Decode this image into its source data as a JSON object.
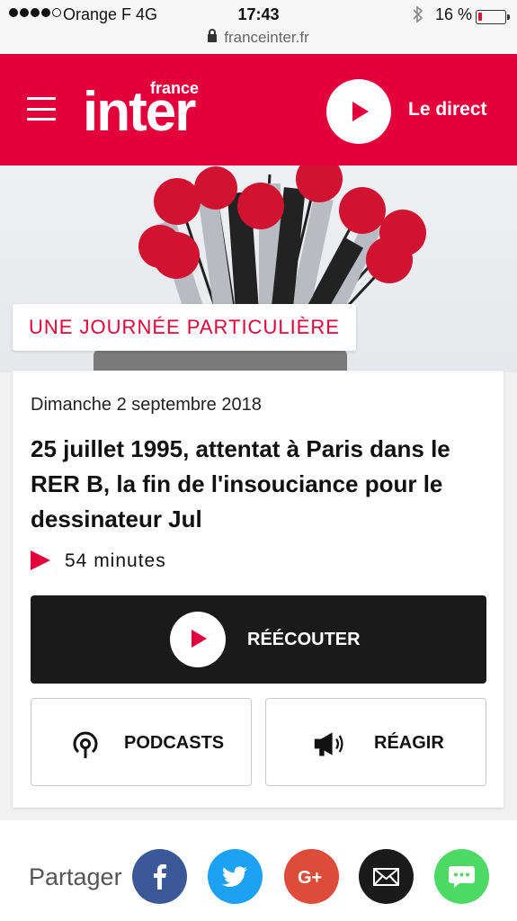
{
  "status_bar": {
    "carrier": "Orange F   4G",
    "time": "17:43",
    "battery_pct_text": "16 %",
    "battery_level": 0.16,
    "url": "franceinter.fr"
  },
  "header": {
    "logo_small": "france",
    "logo_big": "inter",
    "live_label": "Le direct"
  },
  "episode": {
    "show_tag": "UNE JOURNÉE PARTICULIÈRE",
    "date": "Dimanche 2 septembre 2018",
    "title": "25 juillet 1995, attentat à Paris dans le RER B, la fin de l'insouciance pour le dessinateur Jul",
    "duration": "54 minutes"
  },
  "actions": {
    "replay_label": "RÉÉCOUTER",
    "podcasts_label": "PODCASTS",
    "react_label": "RÉAGIR"
  },
  "share": {
    "label": "Partager",
    "buttons": [
      {
        "name": "facebook",
        "icon": "facebook-icon",
        "color": "#3b5998"
      },
      {
        "name": "twitter",
        "icon": "twitter-icon",
        "color": "#1da1f2"
      },
      {
        "name": "google-plus",
        "icon": "google-plus-icon",
        "color": "#dd4b39"
      },
      {
        "name": "email",
        "icon": "mail-icon",
        "color": "#1a1a1a"
      },
      {
        "name": "message",
        "icon": "chat-icon",
        "color": "#4cd964"
      }
    ]
  },
  "colors": {
    "brand_red": "#e4003a",
    "dark": "#1a1a1a"
  }
}
